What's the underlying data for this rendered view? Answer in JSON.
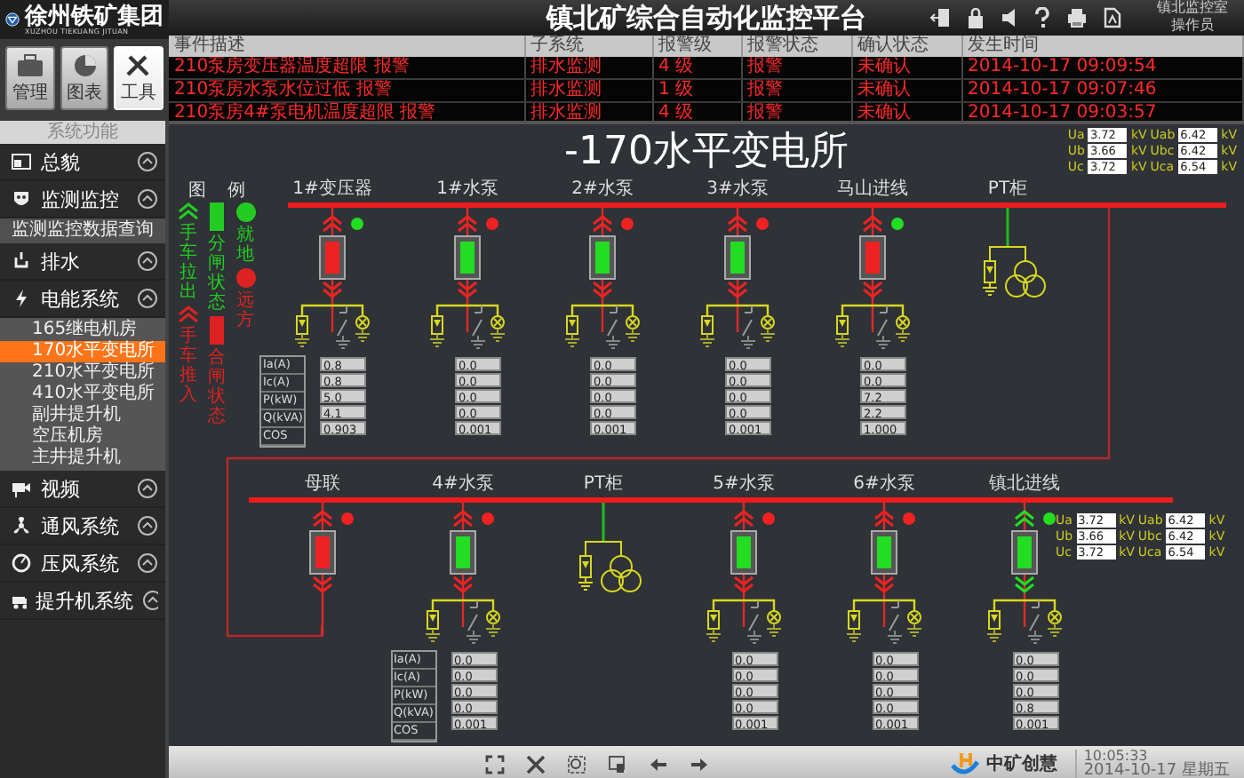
{
  "header": {
    "logo_text": "徐州铁矿集团",
    "logo_subtext": "XUZHOU TIEKUANG JITUAN",
    "title": "镇北矿综合自动化监控平台",
    "user": {
      "location": "镇北监控室",
      "role": "操作员"
    }
  },
  "toolbar": [
    {
      "label": "管理",
      "selected": false
    },
    {
      "label": "图表",
      "selected": false
    },
    {
      "label": "工具",
      "selected": true
    }
  ],
  "alarms": {
    "columns": [
      "事件描述",
      "子系统",
      "报警级",
      "报警状态",
      "确认状态",
      "发生时间"
    ],
    "rows": [
      [
        "210泵房变压器温度超限 报警",
        "排水监测",
        "4 级",
        "报警",
        "未确认",
        "2014-10-17 09:09:54"
      ],
      [
        "210泵房水泵水位过低 报警",
        "排水监测",
        "1 级",
        "报警",
        "未确认",
        "2014-10-17 09:07:46"
      ],
      [
        "210泵房4#泵电机温度超限 报警",
        "排水监测",
        "4 级",
        "报警",
        "未确认",
        "2014-10-17 09:03:57"
      ]
    ]
  },
  "sidebar": {
    "header": "系统功能",
    "items": [
      {
        "label": "总貌"
      },
      {
        "label": "监测监控",
        "children": [
          {
            "label": "监测监控数据查询",
            "selected": false
          }
        ]
      },
      {
        "label": "排水"
      },
      {
        "label": "电能系统",
        "children": [
          {
            "label": "165继电机房",
            "selected": false
          },
          {
            "label": "170水平变电所",
            "selected": true
          },
          {
            "label": "210水平变电所",
            "selected": false
          },
          {
            "label": "410水平变电所",
            "selected": false
          },
          {
            "label": "副井提升机",
            "selected": false
          },
          {
            "label": "空压机房",
            "selected": false
          },
          {
            "label": "主井提升机",
            "selected": false
          }
        ]
      },
      {
        "label": "视频"
      },
      {
        "label": "通风系统"
      },
      {
        "label": "压风系统"
      },
      {
        "label": "提升机系统"
      }
    ]
  },
  "diagram": {
    "title": "-170水平变电所",
    "legend": {
      "title": "图例",
      "columns": [
        {
          "kind": "chevron",
          "items": [
            {
              "label": "手车拉出",
              "color": "#22cc22"
            },
            {
              "label": "手车推入",
              "color": "#dd2222"
            }
          ]
        },
        {
          "kind": "bar",
          "items": [
            {
              "label": "分闸状态",
              "color": "#22cc22"
            },
            {
              "label": "合闸状态",
              "color": "#dd2222"
            }
          ]
        },
        {
          "kind": "dot",
          "items": [
            {
              "label": "就地",
              "color": "#22cc22"
            },
            {
              "label": "远方",
              "color": "#dd2222"
            }
          ]
        }
      ]
    },
    "sections": [
      {
        "row_labels": [
          "Ia(A)",
          "Ic(A)",
          "P(kW)",
          "Q(kVA)",
          "COS"
        ],
        "voltages": [
          {
            "label": "Ua",
            "value": "3.72",
            "unit": "kV"
          },
          {
            "label": "Uab",
            "value": "6.42",
            "unit": "kV"
          },
          {
            "label": "Ub",
            "value": "3.66",
            "unit": "kV"
          },
          {
            "label": "Ubc",
            "value": "6.42",
            "unit": "kV"
          },
          {
            "label": "Uc",
            "value": "3.72",
            "unit": "kV"
          },
          {
            "label": "Uca",
            "value": "6.54",
            "unit": "kV"
          }
        ],
        "bays": [
          {
            "kind": "feeder",
            "label": "1#变压器",
            "closed": true,
            "remote": false,
            "cart_out": false,
            "values": [
              "0.8",
              "0.8",
              "5.0",
              "4.1",
              "0.903"
            ]
          },
          {
            "kind": "feeder",
            "label": "1#水泵",
            "closed": false,
            "remote": true,
            "cart_out": false,
            "values": [
              "0.0",
              "0.0",
              "0.0",
              "0.0",
              "0.001"
            ]
          },
          {
            "kind": "feeder",
            "label": "2#水泵",
            "closed": false,
            "remote": true,
            "cart_out": false,
            "values": [
              "0.0",
              "0.0",
              "0.0",
              "0.0",
              "0.001"
            ]
          },
          {
            "kind": "feeder",
            "label": "3#水泵",
            "closed": false,
            "remote": true,
            "cart_out": false,
            "values": [
              "0.0",
              "0.0",
              "0.0",
              "0.0",
              "0.001"
            ]
          },
          {
            "kind": "feeder",
            "label": "马山进线",
            "closed": true,
            "remote": false,
            "cart_out": false,
            "values": [
              "0.0",
              "0.0",
              "7.2",
              "2.2",
              "1.000"
            ]
          },
          {
            "kind": "pt",
            "label": "PT柜"
          }
        ]
      },
      {
        "row_labels": [
          "Ia(A)",
          "Ic(A)",
          "P(kW)",
          "Q(kVA)",
          "COS"
        ],
        "voltages": [
          {
            "label": "Ua",
            "value": "3.72",
            "unit": "kV"
          },
          {
            "label": "Uab",
            "value": "6.42",
            "unit": "kV"
          },
          {
            "label": "Ub",
            "value": "3.66",
            "unit": "kV"
          },
          {
            "label": "Ubc",
            "value": "6.42",
            "unit": "kV"
          },
          {
            "label": "Uc",
            "value": "3.72",
            "unit": "kV"
          },
          {
            "label": "Uca",
            "value": "6.54",
            "unit": "kV"
          }
        ],
        "bays": [
          {
            "kind": "tie",
            "label": "母联",
            "closed": true,
            "remote": true,
            "cart_out": false
          },
          {
            "kind": "feeder",
            "label": "4#水泵",
            "closed": false,
            "remote": true,
            "cart_out": false,
            "values": [
              "0.0",
              "0.0",
              "0.0",
              "0.0",
              "0.001"
            ]
          },
          {
            "kind": "pt",
            "label": "PT柜"
          },
          {
            "kind": "feeder",
            "label": "5#水泵",
            "closed": false,
            "remote": true,
            "cart_out": false,
            "values": [
              "0.0",
              "0.0",
              "0.0",
              "0.0",
              "0.001"
            ]
          },
          {
            "kind": "feeder",
            "label": "6#水泵",
            "closed": false,
            "remote": true,
            "cart_out": false,
            "values": [
              "0.0",
              "0.0",
              "0.0",
              "0.0",
              "0.001"
            ]
          },
          {
            "kind": "feeder",
            "label": "镇北进线",
            "closed": false,
            "remote": false,
            "cart_out": true,
            "values": [
              "0.0",
              "0.0",
              "0.0",
              "0.8",
              "0.001"
            ]
          }
        ]
      }
    ]
  },
  "status_bar": {
    "brand": "中矿创慧",
    "time": "10:05:33",
    "date": "2014-10-17 星期五"
  }
}
